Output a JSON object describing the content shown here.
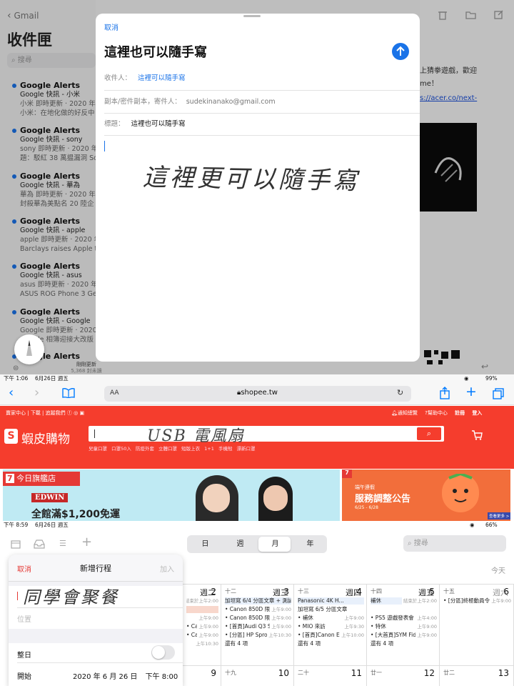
{
  "panel1": {
    "back_label": "Gmail",
    "inbox_title": "收件匣",
    "search_placeholder": "搜尋",
    "mails": [
      {
        "sender": "Google Alerts",
        "subject": "Google 快訊 - 小米",
        "l1": "小米 即時更新 · 2020 年",
        "l2": "小米：在地化做的好反中"
      },
      {
        "sender": "Google Alerts",
        "subject": "Google 快訊 - sony",
        "l1": "sony 即時更新 · 2020 年",
        "l2": "題：駁紅 38 萬揾漏洞 So"
      },
      {
        "sender": "Google Alerts",
        "subject": "Google 快訊 - 華為",
        "l1": "華為 即時更新 · 2020 年",
        "l2": "封殺華為美點名 20 陸企"
      },
      {
        "sender": "Google Alerts",
        "subject": "Google 快訊 - apple",
        "l1": "apple 即時更新 · 2020 年",
        "l2": "Barclays raises Apple ta"
      },
      {
        "sender": "Google Alerts",
        "subject": "Google 快訊 - asus",
        "l1": "asus 即時更新 · 2020 年",
        "l2": "ASUS ROG Phone 3 Get"
      },
      {
        "sender": "Google Alerts",
        "subject": "Google 快訊 - Google",
        "l1": "Google 即時更新 · 2020",
        "l2": "Google 相簿迎接大改版"
      },
      {
        "sender": "Google Alerts",
        "subject": "",
        "l1": "",
        "l2": ""
      }
    ],
    "updated_label": "剛剛更新",
    "updated_sub": "5,368 封未讀",
    "right_text_1": "上猜拳遊戲，歡迎",
    "right_text_2": "me！",
    "right_link": "s://acer.co/next-",
    "compose": {
      "cancel": "取消",
      "title": "這裡也可以隨手寫",
      "to_label": "收件人：",
      "to_value": "這裡可以隨手寫",
      "cc_label": "副本/密件副本，寄件人：",
      "cc_value": "sudekinanako@gmail.com",
      "subject_label": "標題：",
      "subject_value": "這裡也可以隨手寫",
      "handwriting": "這裡更可以隨手寫"
    }
  },
  "panel2": {
    "status_time": "下午 1:06",
    "status_date": "6月26日 週五",
    "battery": "99%",
    "aa_label": "AA",
    "url": "shopee.tw",
    "topbar_left": [
      "賣家中心",
      "下載",
      "追蹤我們"
    ],
    "topbar_right": [
      "通知總覽",
      "幫助中心",
      "註冊",
      "登入"
    ],
    "logo_text": "蝦皮購物",
    "search_handwriting": "USB 電風扇",
    "hot_keywords": [
      "兒童口罩",
      "口罩50入",
      "防疫外套",
      "立體口罩",
      "短版上衣",
      "1+1 手機殼",
      "漂新口罩"
    ],
    "banner_left_tag": "今日旗艦店",
    "banner_left_brand": "EDWIN",
    "banner_left_text": "全館滿$1,200免運",
    "banner_right_tag": "端午連假",
    "banner_right_text": "服務調整公告",
    "banner_right_date": "6/25 - 6/28",
    "banner_right_more": "查看更多 >"
  },
  "panel3": {
    "status_time": "下午 8:59",
    "status_date": "6月26日 週五",
    "battery": "66%",
    "view_tabs": [
      "日",
      "週",
      "月",
      "年"
    ],
    "active_tab": "月",
    "search_placeholder": "搜尋",
    "today_label": "今天",
    "weekdays": [
      "週二",
      "週三",
      "週四",
      "週五",
      "週六"
    ],
    "new_event": {
      "cancel": "取消",
      "title": "新增行程",
      "add": "加入",
      "title_handwriting": "同學會聚餐",
      "location_placeholder": "位置",
      "all_day_label": "整日",
      "start_label": "開始",
      "start_date": "2020 年 6 月 26 日",
      "start_time": "下午 8:00"
    },
    "week1": [
      {
        "num": "2",
        "lunar": "",
        "events": [
          {
            "t": "",
            "tm": "結束於上午2:00"
          },
          {
            "t": "",
            "tm": ""
          },
          {
            "t": "",
            "tm": "上午9:00"
          },
          {
            "t": "• Canon 850D 限豆...",
            "tm": "上午9:00"
          },
          {
            "t": "• Canon 850D 限豆...",
            "tm": "上午9:00"
          },
          {
            "t": "",
            "tm": "上午10:30"
          }
        ]
      },
      {
        "num": "3",
        "lunar": "十二",
        "events": [
          {
            "t": "加坦寫 6/4 分區文章 + 測試",
            "tm": ""
          },
          {
            "t": "• Canon 850D 限豆...",
            "tm": "上午9:00"
          },
          {
            "t": "• Canon 850D 限豆...",
            "tm": "上午9:00"
          },
          {
            "t": "• [首頁]Audi Q3 Sp...",
            "tm": "上午9:00"
          },
          {
            "t": "• [分區] HP Sproc...",
            "tm": "上午10:30"
          },
          {
            "t": "還有 4 項",
            "tm": ""
          }
        ]
      },
      {
        "num": "4",
        "lunar": "十三",
        "events": [
          {
            "t": "Panasonic 4K H...",
            "tm": ""
          },
          {
            "t": "加坦寫 6/5 分區文章",
            "tm": ""
          },
          {
            "t": "• 補休",
            "tm": "上午9:00"
          },
          {
            "t": "• MIO 來訪",
            "tm": "上午9:30"
          },
          {
            "t": "• [首頁]Canon EOS...",
            "tm": "上午10:00"
          },
          {
            "t": "還有 4 項",
            "tm": ""
          }
        ]
      },
      {
        "num": "5",
        "lunar": "十四",
        "events": [
          {
            "t": "補休",
            "tm": "結束於上午2:00"
          },
          {
            "t": "",
            "tm": ""
          },
          {
            "t": "• PS5 遊戲發表會",
            "tm": "上午4:00"
          },
          {
            "t": "• 特休",
            "tm": "上午9:00"
          },
          {
            "t": "• [大首頁]SYM Fiddle...",
            "tm": "上午9:00"
          },
          {
            "t": "還有 4 項",
            "tm": ""
          }
        ]
      },
      {
        "num": "6",
        "lunar": "十五",
        "events": [
          {
            "t": "• [分區]終極動員令...",
            "tm": "上午9:00"
          }
        ]
      }
    ],
    "week2": [
      {
        "num": "9",
        "lunar": ""
      },
      {
        "num": "10",
        "lunar": "十九"
      },
      {
        "num": "11",
        "lunar": "二十"
      },
      {
        "num": "12",
        "lunar": "廿一"
      },
      {
        "num": "13",
        "lunar": "廿二"
      }
    ],
    "colors": {
      "accent": "#1a73e8",
      "shopee": "#ee4d2d",
      "ios_blue": "#007aff"
    }
  }
}
